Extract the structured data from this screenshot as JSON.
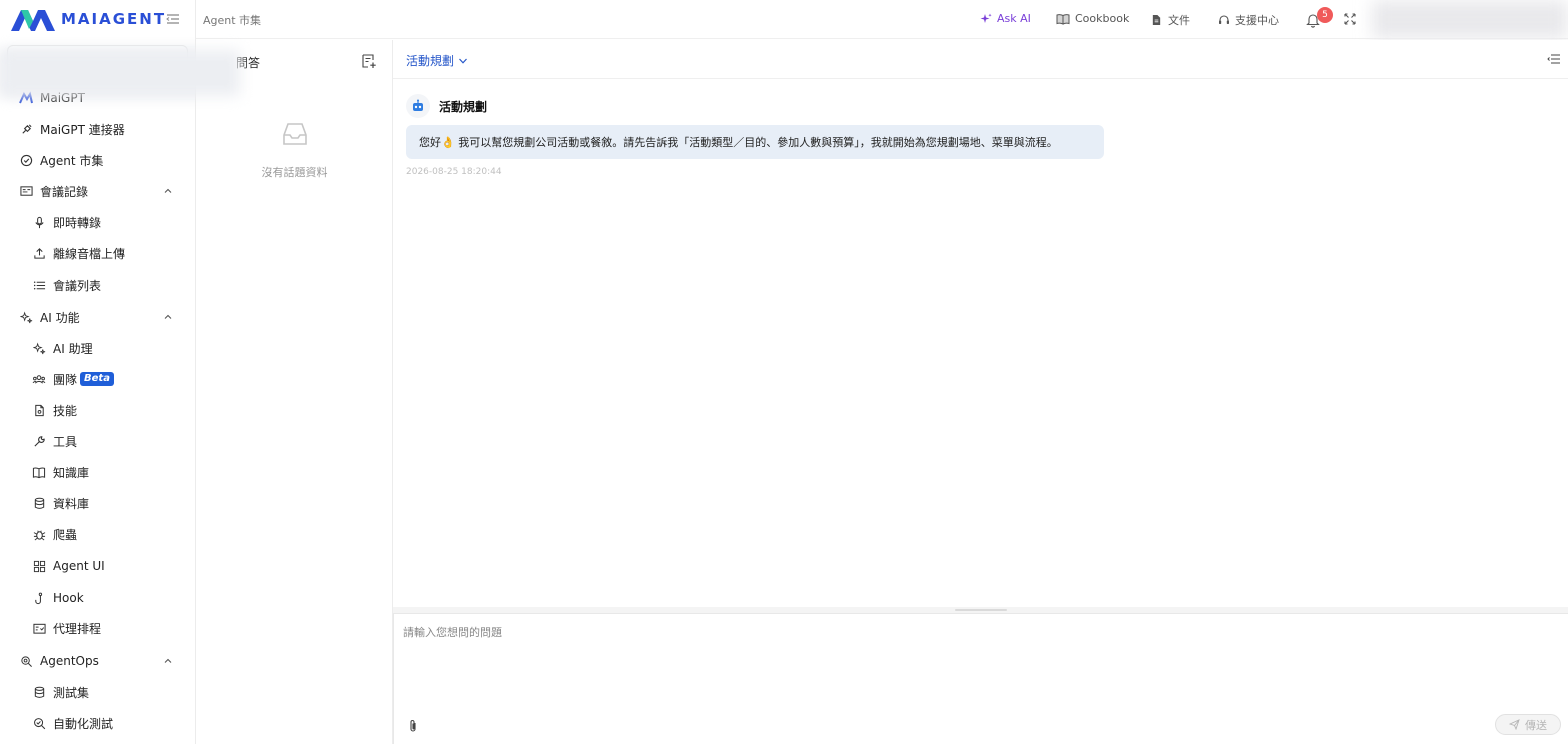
{
  "brand": {
    "name": "MAIAGENT"
  },
  "sidebar": {
    "items": [
      {
        "label": "MaiGPT",
        "icon": "maigpt-icon"
      },
      {
        "label": "MaiGPT 連接器",
        "icon": "plug-icon"
      },
      {
        "label": "Agent 市集",
        "icon": "check-circle-icon"
      },
      {
        "label": "會議記錄",
        "icon": "meeting-icon"
      },
      {
        "label": "即時轉錄",
        "icon": "mic-icon"
      },
      {
        "label": "離線音檔上傳",
        "icon": "upload-icon"
      },
      {
        "label": "會議列表",
        "icon": "list-icon"
      },
      {
        "label": "AI 功能",
        "icon": "sparkle-icon"
      },
      {
        "label": "AI 助理",
        "icon": "sparkle-icon"
      },
      {
        "label": "團隊",
        "icon": "team-icon",
        "badge": "Beta"
      },
      {
        "label": "技能",
        "icon": "file-icon"
      },
      {
        "label": "工具",
        "icon": "wrench-icon"
      },
      {
        "label": "知識庫",
        "icon": "book-icon"
      },
      {
        "label": "資料庫",
        "icon": "database-icon"
      },
      {
        "label": "爬蟲",
        "icon": "bug-icon"
      },
      {
        "label": "Agent UI",
        "icon": "grid-icon"
      },
      {
        "label": "Hook",
        "icon": "hook-icon"
      },
      {
        "label": "代理排程",
        "icon": "schedule-icon"
      },
      {
        "label": "AgentOps",
        "icon": "ops-icon"
      },
      {
        "label": "測試集",
        "icon": "database-icon"
      },
      {
        "label": "自動化測試",
        "icon": "search-check-icon"
      }
    ]
  },
  "header": {
    "breadcrumb": "Agent 市集",
    "links": {
      "ask_ai": "Ask AI",
      "cookbook": "Cookbook",
      "docs": "文件",
      "support": "支援中心"
    },
    "notification_count": "5"
  },
  "topics": {
    "title": "問答",
    "empty_text": "沒有話題資料"
  },
  "chat": {
    "agent_name": "活動規劃",
    "bot_name": "活動規劃",
    "message": "您好👌 我可以幫您規劃公司活動或餐敘。請先告訴我「活動類型／目的、參加人數與預算」，我就開始為您規劃場地、菜單與流程。",
    "timestamp": "2026-08-25 18:20:44",
    "input_placeholder": "請輸入您想問的問題",
    "send_label": "傳送"
  },
  "colors": {
    "brand_blue": "#2a4fd6",
    "accent_purple": "#7a3fd8",
    "bubble_bg": "#e7eef7",
    "badge_red": "#f05a5a",
    "beta_blue": "#1f5ed8"
  }
}
